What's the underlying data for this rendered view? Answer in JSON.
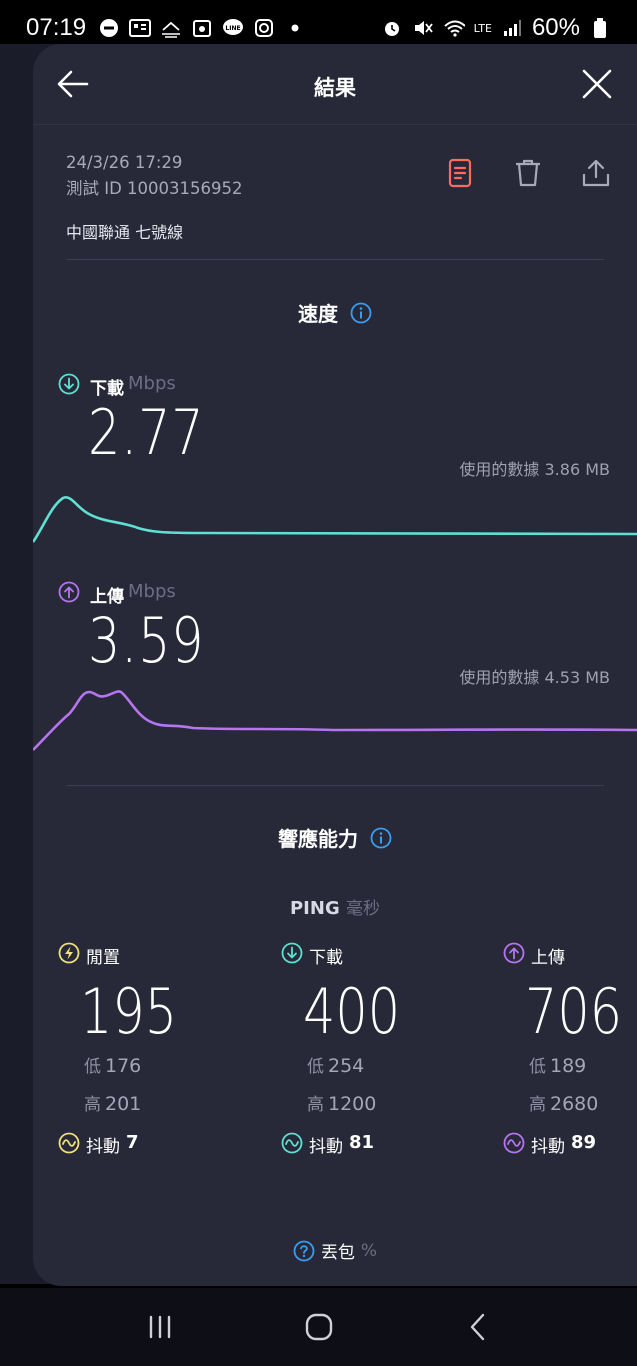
{
  "status_bar": {
    "time": "07:19",
    "battery": "60%",
    "network": "LTE"
  },
  "header": {
    "title": "結果"
  },
  "result": {
    "datetime": "24/3/26 17:29",
    "test_id": "測試 ID 10003156952",
    "isp": "中國聯通 七號線"
  },
  "speed": {
    "section_title": "速度",
    "download": {
      "label": "下載",
      "unit": "Mbps",
      "value": "2.77",
      "data_used": "使用的數據 3.86 MB",
      "color": "#5fe0d2"
    },
    "upload": {
      "label": "上傳",
      "unit": "Mbps",
      "value": "3.59",
      "data_used": "使用的數據 4.53 MB",
      "color": "#b675f0"
    }
  },
  "responsiveness": {
    "section_title": "響應能力",
    "ping_title": "PING",
    "ping_unit": "毫秒",
    "idle": {
      "label": "閒置",
      "value": "195",
      "low_label": "低",
      "low": "176",
      "high_label": "高",
      "high": "201",
      "jitter_label": "抖動",
      "jitter": "7",
      "color": "#efe07a"
    },
    "download": {
      "label": "下載",
      "value": "400",
      "low_label": "低",
      "low": "254",
      "high_label": "高",
      "high": "1200",
      "jitter_label": "抖動",
      "jitter": "81",
      "color": "#5fe0d2"
    },
    "upload": {
      "label": "上傳",
      "value": "706",
      "low_label": "低",
      "low": "189",
      "high_label": "高",
      "high": "2680",
      "jitter_label": "抖動",
      "jitter": "89",
      "color": "#b675f0"
    }
  },
  "packet_loss": {
    "label": "丟包",
    "unit": "%"
  },
  "colors": {
    "accent_info": "#3a9ef0",
    "report_icon": "#ff6b5f"
  }
}
